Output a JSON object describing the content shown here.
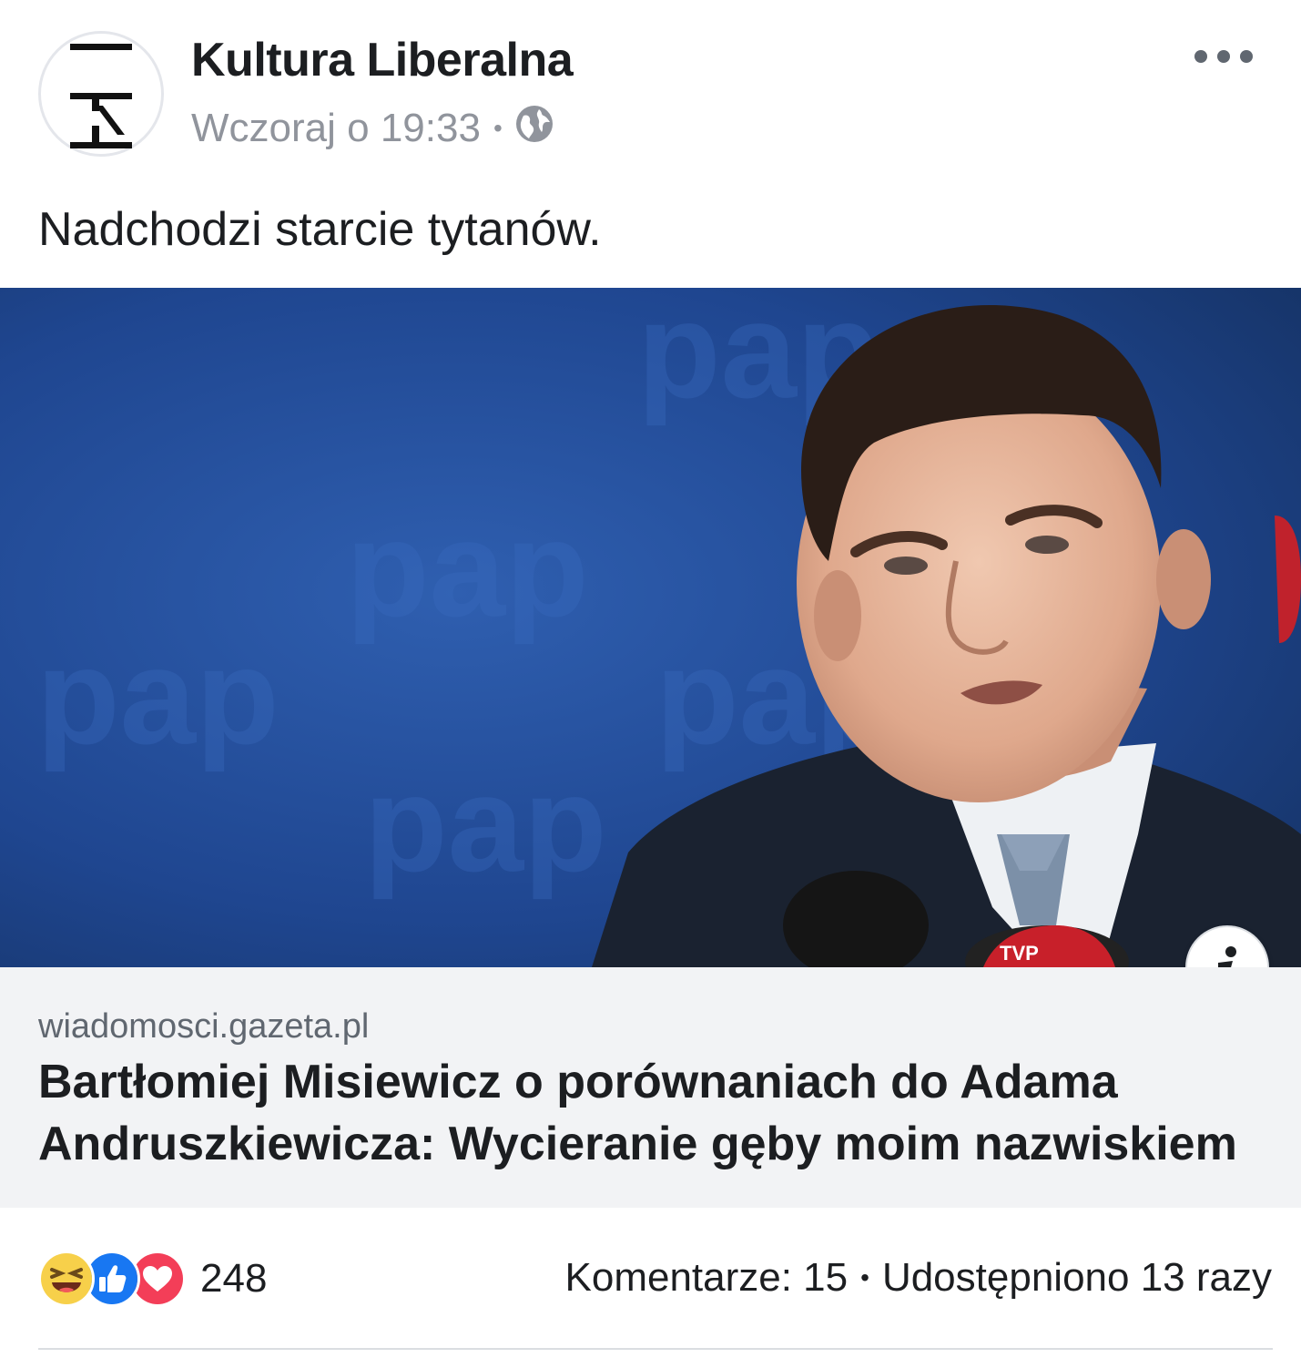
{
  "header": {
    "page_name": "Kultura Liberalna",
    "timestamp": "Wczoraj o 19:33",
    "separator": "•",
    "privacy_icon": "globe-icon",
    "more_icon": "more-horizontal-icon"
  },
  "post": {
    "text": "Nadchodzi starcie tytanów."
  },
  "link": {
    "domain": "wiadomosci.gazeta.pl",
    "title": "Bartłomiej Misiewicz o porównaniach do Adama Andruszkiewicza: Wycieranie gęby moim nazwiskiem",
    "info_icon": "info-icon"
  },
  "stats": {
    "reactions": [
      "haha-icon",
      "like-icon",
      "love-icon"
    ],
    "reaction_count": "248",
    "comments": "Komentarze: 15",
    "separator": "•",
    "shares": "Udostępniono 13 razy"
  },
  "colors": {
    "text_primary": "#1c1e21",
    "text_secondary": "#90949c",
    "link_background": "#f2f3f5",
    "like_blue": "#1877f2",
    "love_red": "#f33e58",
    "haha_yellow": "#f7d04a"
  }
}
